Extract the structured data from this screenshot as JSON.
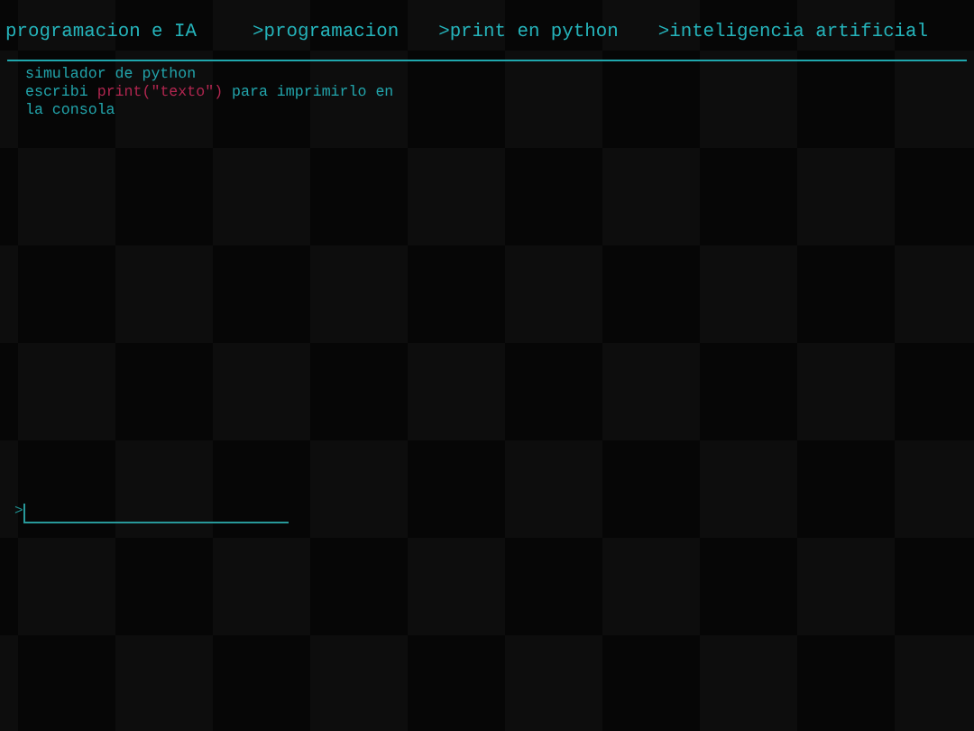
{
  "nav": {
    "title": "programacion e IA",
    "links": [
      {
        "label": ">programacion"
      },
      {
        "label": ">print en python"
      },
      {
        "label": ">inteligencia artificial"
      }
    ]
  },
  "intro": {
    "heading": "simulador de python",
    "instruction": [
      {
        "kind": "plain",
        "text": "escribi "
      },
      {
        "kind": "code",
        "text": "print(\"texto\")"
      },
      {
        "kind": "plain",
        "text": " para imprimirlo en la consola"
      }
    ]
  },
  "console": {
    "prompt": ">"
  }
}
